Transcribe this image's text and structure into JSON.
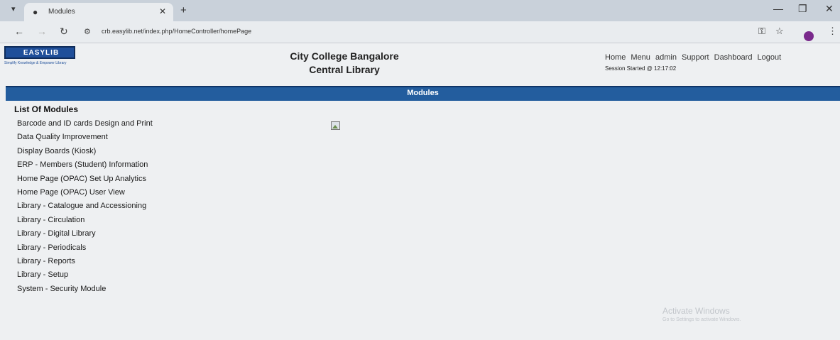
{
  "browser": {
    "tab_title": "Modules",
    "address": "crb.easylib.net/index.php/HomeController/homePage",
    "icons": {
      "tab_caret": "chevron-down-icon",
      "favicon": "globe-icon",
      "tab_close": "close-icon",
      "new_tab": "plus-icon",
      "minimize": "minimize-icon",
      "maximize": "maximize-icon",
      "close": "close-icon",
      "back": "back-arrow-icon",
      "forward": "forward-arrow-icon",
      "reload": "reload-icon",
      "site_info": "tune-icon",
      "key": "key-icon",
      "bookmark": "star-icon",
      "menu": "more-vert-icon"
    },
    "profile_color": "#7a2a8c"
  },
  "header": {
    "logo_text": "EASYLIB",
    "logo_tagline": "Simplify Knowledge & Empower Library",
    "college_name": "City College Bangalore",
    "library_name": "Central Library",
    "nav_links": [
      "Home",
      "Menu",
      "admin",
      "Support",
      "Dashboard",
      "Logout"
    ],
    "session": "Session Started @ 12:17:02"
  },
  "main": {
    "band_title": "Modules",
    "band_color": "#235d9e",
    "list_heading": "List Of Modules",
    "modules": [
      "Barcode and ID cards Design and Print",
      "Data Quality Improvement",
      "Display Boards (Kiosk)",
      "ERP - Members (Student) Information",
      "Home Page (OPAC) Set Up Analytics",
      "Home Page (OPAC) User View",
      "Library - Catalogue and Accessioning",
      "Library - Circulation",
      "Library - Digital Library",
      "Library - Periodicals",
      "Library - Reports",
      "Library - Setup",
      "System - Security Module"
    ]
  },
  "watermark": {
    "title": "Activate Windows",
    "subtitle": "Go to Settings to activate Windows."
  }
}
